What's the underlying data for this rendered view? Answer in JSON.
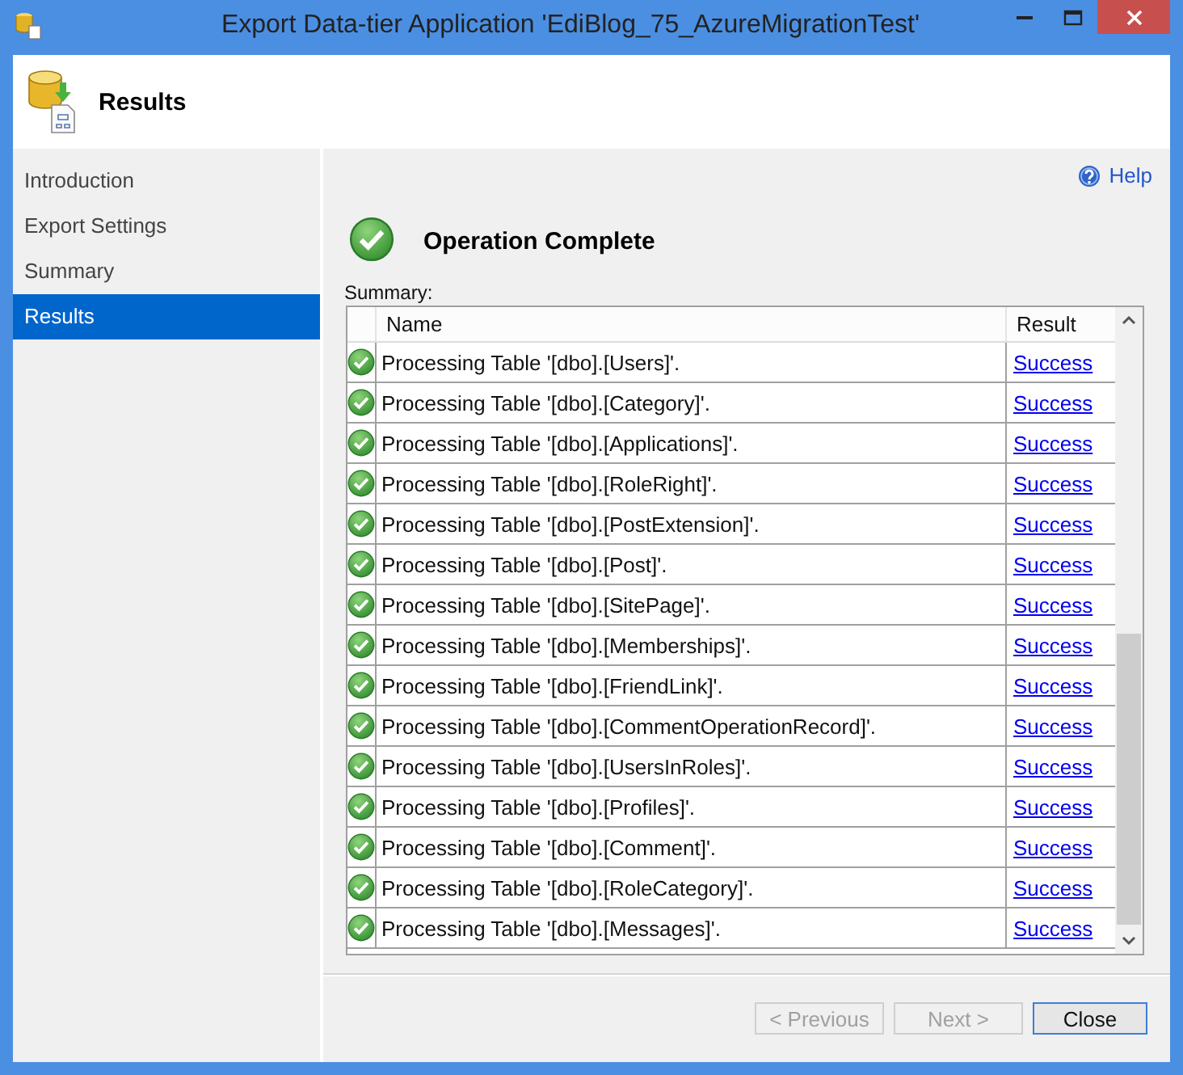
{
  "window": {
    "title": "Export Data-tier Application 'EdiBlog_75_AzureMigrationTest'"
  },
  "header": {
    "title": "Results"
  },
  "nav": {
    "items": [
      {
        "label": "Introduction",
        "selected": false
      },
      {
        "label": "Export Settings",
        "selected": false
      },
      {
        "label": "Summary",
        "selected": false
      },
      {
        "label": "Results",
        "selected": true
      }
    ]
  },
  "help": {
    "label": "Help"
  },
  "status": {
    "title": "Operation Complete"
  },
  "summary": {
    "label": "Summary:",
    "columns": [
      "Name",
      "Result"
    ],
    "rows": [
      {
        "name": "Processing Table '[dbo].[Users]'.",
        "result": "Success"
      },
      {
        "name": "Processing Table '[dbo].[Category]'.",
        "result": "Success"
      },
      {
        "name": "Processing Table '[dbo].[Applications]'.",
        "result": "Success"
      },
      {
        "name": "Processing Table '[dbo].[RoleRight]'.",
        "result": "Success"
      },
      {
        "name": "Processing Table '[dbo].[PostExtension]'.",
        "result": "Success"
      },
      {
        "name": "Processing Table '[dbo].[Post]'.",
        "result": "Success"
      },
      {
        "name": "Processing Table '[dbo].[SitePage]'.",
        "result": "Success"
      },
      {
        "name": "Processing Table '[dbo].[Memberships]'.",
        "result": "Success"
      },
      {
        "name": "Processing Table '[dbo].[FriendLink]'.",
        "result": "Success"
      },
      {
        "name": "Processing Table '[dbo].[CommentOperationRecord]'.",
        "result": "Success"
      },
      {
        "name": "Processing Table '[dbo].[UsersInRoles]'.",
        "result": "Success"
      },
      {
        "name": "Processing Table '[dbo].[Profiles]'.",
        "result": "Success"
      },
      {
        "name": "Processing Table '[dbo].[Comment]'.",
        "result": "Success"
      },
      {
        "name": "Processing Table '[dbo].[RoleCategory]'.",
        "result": "Success"
      },
      {
        "name": "Processing Table '[dbo].[Messages]'.",
        "result": "Success"
      }
    ]
  },
  "buttons": [
    {
      "label": "< Previous",
      "disabled": true
    },
    {
      "label": "Next >",
      "disabled": true
    },
    {
      "label": "Close",
      "disabled": false
    }
  ]
}
